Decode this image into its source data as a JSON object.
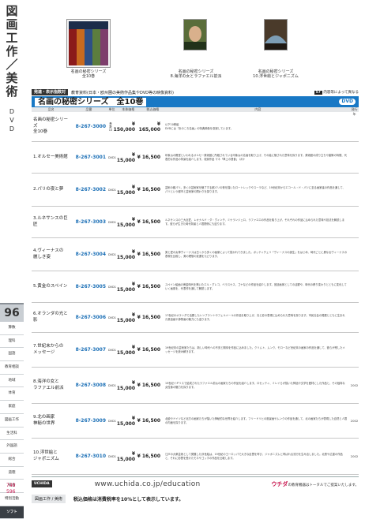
{
  "side_title_chars": [
    "図",
    "画",
    "工",
    "作",
    "／",
    "美",
    "術"
  ],
  "side_subtitle_chars": [
    "D",
    "V",
    "D"
  ],
  "page_number": "96",
  "side_nav": [
    {
      "label": "算数",
      "active": false
    },
    {
      "label": "理科",
      "active": false
    },
    {
      "label": "国語",
      "active": false
    },
    {
      "label": "教育相談",
      "active": false
    },
    {
      "label": "地域",
      "active": false
    },
    {
      "label": "体育",
      "active": false
    },
    {
      "label": "家庭",
      "active": false
    },
    {
      "label": "図画工作",
      "active": false
    },
    {
      "label": "生活科",
      "active": false
    },
    {
      "label": "外国語",
      "active": false
    },
    {
      "label": "総合",
      "active": false
    },
    {
      "label": "道徳",
      "active": false
    },
    {
      "label": "社会",
      "active": false
    },
    {
      "label": "特別活動",
      "active": false
    },
    {
      "label": "ソフト",
      "active": true
    }
  ],
  "side_numbers": [
    "748",
    "596"
  ],
  "photos": [
    {
      "caption_1": "名画の秘密シリーズ",
      "caption_2": "全10巻"
    },
    {
      "caption_1": "名画の秘密シリーズ",
      "caption_2": "8.海洋の女とラファエル前派"
    },
    {
      "caption_1": "名画の秘密シリーズ",
      "caption_2": "10.浮世絵とジャポニズム"
    }
  ],
  "category": {
    "key": "発達・表示指数対",
    "text": "教育資料(日本・欧州圏の美術作品集やDVD等の映像資料)",
    "right_badge": "57",
    "right_text": "内容等によって異なる"
  },
  "banner": {
    "title": "名画の秘密シリーズ　全10巻",
    "badge": "DVD"
  },
  "table_headers": [
    "品名",
    "品番",
    "単位",
    "本体価格",
    "税込価格",
    "内容",
    "発行年"
  ],
  "rows": [
    {
      "name": "名画の秘密シリーズ\n全10巻",
      "no": "8-267-3000",
      "unit": "巻数10",
      "price": "¥ 150,000",
      "tax": "¥ 165,000",
      "desc": "以下10巻組\nDVDには「あのころ名画」の特典映像を収録しています。",
      "year": ""
    },
    {
      "name": "1.オルセー美術館",
      "no": "8-267-3001",
      "unit": "DVD1",
      "price": "¥ 15,000",
      "tax": "¥ 16,500",
      "desc": "印象派の殿堂といわれるオルセー美術館に所蔵されている印象派の名画を取り上げ、その絵に隠された意味を探ります。美術館の成り立ちや建築の特徴、代表的な作品の背景を紹介します。収録作品 マネ「草上の昼食」 ほか",
      "year": ""
    },
    {
      "name": "2.パリの夜と夢",
      "no": "8-267-3002",
      "unit": "DVD1",
      "price": "¥ 15,000",
      "tax": "¥ 16,500",
      "desc": "芸術の都パリ。多くの芸術家を魅了する都パリの夜を描いたロートレックやスーラなど、19世紀末からエコール・ド・パリに至る画家達の作品を通して、パリという都市と芸術家の関わりを探ります。",
      "year": ""
    },
    {
      "name": "3.ルネサンスの巨匠",
      "no": "8-267-3003",
      "unit": "DVD1",
      "price": "¥ 15,000",
      "tax": "¥ 16,500",
      "desc": "ルネサンスの三大巨匠、レオナルド・ダ・ヴィンチ、ミケランジェロ、ラファエロの作品を取り上げ、それぞれの作品に込められた意味や技法を解説します。彼らが生きた時代背景と人間関係にも迫ります。",
      "year": ""
    },
    {
      "name": "4.ヴィーナスの\n麗しき姿",
      "no": "8-267-3004",
      "unit": "DVD1",
      "price": "¥ 15,000",
      "tax": "¥ 16,500",
      "desc": "美と愛の女神ヴィーナスは古くから多くの画家によって描かれてきました。ボッティチェリ「ヴィーナスの誕生」をはじめ、時代ごとに異なるヴィーナスの表現を比較し、美の理想の変遷をたどります。",
      "year": ""
    },
    {
      "name": "5.黄金のスペイン",
      "no": "8-267-3005",
      "unit": "DVD1",
      "price": "¥ 15,000",
      "tax": "¥ 16,500",
      "desc": "スペイン絵画の黄金時代を築いたエル・グレコ、ベラスケス、ゴヤなどの作品を紹介します。宮廷画家としての活躍や、時代の移り変わりとともに変化していく画風を、代表作を通して解説します。",
      "year": ""
    },
    {
      "name": "6.オランダの光と影",
      "no": "8-267-3006",
      "unit": "DVD1",
      "price": "¥ 15,000",
      "tax": "¥ 16,500",
      "desc": "17世紀のオランダで活躍したレンブラントやフェルメールの作品を取り上げ、光と影の表現に込められた意味を探ります。市民社会の発展とともに生まれた風俗画や静物画の魅力にも迫ります。",
      "year": ""
    },
    {
      "name": "7.世紀末からの\nメッセージ",
      "no": "8-267-3007",
      "unit": "DVD1",
      "price": "¥ 15,000",
      "tax": "¥ 16,500",
      "desc": "19世紀末の芸術家たちは、新しい時代への不安と期待を作品に込めました。クリムト、ムンク、モローなど世紀末の画家の作品を通して、彼らが残したメッセージを読み解きます。",
      "year": ""
    },
    {
      "name": "8.海洋の女と\nラファエル前派",
      "no": "8-267-3008",
      "unit": "DVD1",
      "price": "¥ 15,000",
      "tax": "¥ 16,500",
      "desc": "19世紀イギリスで結成されたラファエル前派の画家たちの作品を紹介します。ロセッティ、ミレイらが描いた神話や文学を題材にした作品と、その独特な女性像の魅力を探ります。",
      "year": "2002"
    },
    {
      "name": "9.北の画家\n神秘の世界",
      "no": "8-267-3009",
      "unit": "DVD1",
      "price": "¥ 15,000",
      "tax": "¥ 16,500",
      "desc": "北欧やドイツなど北方の画家たちが描いた神秘的な世界を紹介します。フリードリヒの風景画やムンクの作品を通して、北の画家たちが表現した自然と人間の内面を探ります。",
      "year": "2002"
    },
    {
      "name": "10.浮世絵と\nジャポニズム",
      "no": "8-267-3010",
      "unit": "DVD1",
      "price": "¥ 15,000",
      "tax": "¥ 16,500",
      "desc": "江戸の大衆芸術として発展した浮世絵は、19世紀のヨーロッパで大きな反響を呼び、ジャポニズムと呼ばれる流行を生み出しました。北斎や広重の作品と、それに影響を受けたモネやゴッホの作品を比較します。",
      "year": "2002"
    }
  ],
  "footer": {
    "logo": "UCHIDA",
    "url": "www.uchida.co.jp/education",
    "brand": "ウチダ",
    "brand_tag": "の教育機器はトータルでご提案いたします。"
  },
  "bottom": {
    "key": "図画工作 / 美術",
    "note": "税込価格は消費税率を10%として表示しています。"
  }
}
